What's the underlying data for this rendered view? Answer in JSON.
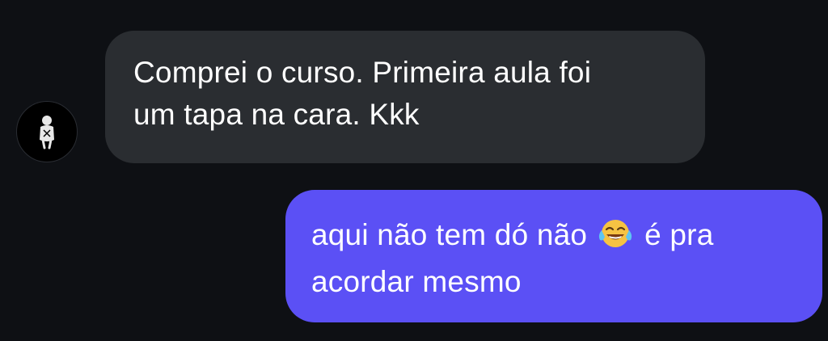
{
  "messages": {
    "incoming": {
      "line1": "Comprei o curso. Primeira aula foi",
      "line2": "um tapa na cara. Kkk"
    },
    "outgoing": {
      "line1_before_emoji": "aqui não tem dó não ",
      "emoji": "face-with-tears-of-joy",
      "line1_after_emoji": " é pra",
      "line2": "acordar mesmo"
    }
  },
  "colors": {
    "background": "#0e1014",
    "incoming_bubble": "#2a2d31",
    "outgoing_bubble": "#5b50f5",
    "text": "#ffffff"
  }
}
